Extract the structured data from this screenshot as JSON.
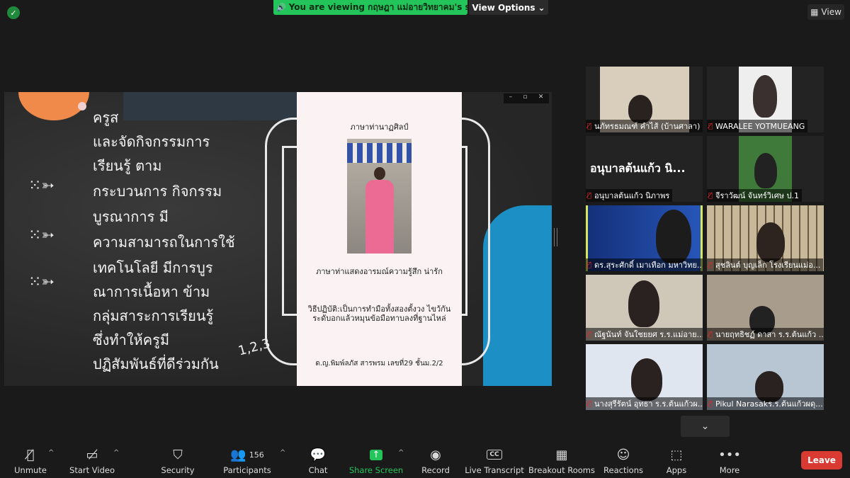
{
  "top": {
    "viewing_text": "You are viewing กฤษฎา แม่อายวิทยาคม's screen",
    "view_options": "View Options",
    "view_button": "View"
  },
  "share": {
    "board_lines": [
      "ครูส",
      "และจัดกิจกรรมการ",
      "เรียนรู้ ตาม",
      "กระบวนการ กิจกรรม",
      "บูรณาการ มี",
      "ความสามารถในการใช้",
      "เทคโนโลยี มีการบูร",
      "ณาการเนื้อหา ข้าม",
      "กลุ่มสาระการเรียนรู้",
      "ซึ่งทำให้ครูมี",
      "ปฏิสัมพันธ์ที่ดีร่วมกัน"
    ],
    "scribble": "1,2,3",
    "card": {
      "title": "ภาษาท่านาฏศิลป์",
      "caption": "ภาษาท่าแสดงอารมณ์ความรู้สึก น่ารัก",
      "method": "วิธีปฏิบัติ:เป็นการทำมือทั้งสองตั้งวง ไขว้กันระดับอกแล้วหมุนข้อมือทาบลงที่ฐานไหล่",
      "student": "ด.ญ.พิมพ์ลภัส สารพรม เลขที่29 ชั้นม.2/2"
    }
  },
  "participants": [
    {
      "name": "นภัทรธมณฑ์ คำไส้ (บ้านศาลา)",
      "bg": "#d9cdbc"
    },
    {
      "name": "WARALEE YOTMUEANG",
      "bg": "#eeeeee"
    },
    {
      "name": "อนุบาลต้นแก้ว นิภาพร",
      "big": "อนุบาลต้นแก้ว นิ...",
      "bg": "#232323"
    },
    {
      "name": "จีราวัฒน์ จันทร์วิเศษ ป.1",
      "bg": "#3f7a3a"
    },
    {
      "name": "ดร.สุระศักดิ์ เมาเทือก มหาวิทย...",
      "bg": "#1e3f8a",
      "active": true
    },
    {
      "name": "สุชลินต์ บุญเล็ก โรงเรียนแม่อ...",
      "bg": "#c8b89a"
    },
    {
      "name": "ณัฐนันท์ จันใชยยศ ร.ร.แม่อาย...",
      "bg": "#cfc8b8"
    },
    {
      "name": "นายฤทธิชฏ์ ดาสา ร.ร.ต้นแก้ว ...",
      "bg": "#a89c8c"
    },
    {
      "name": "นางสุรีรัตน์ อุทธา ร.ร.ต้นแก้วผ...",
      "bg": "#dfe6ef"
    },
    {
      "name": "Pikul Narasakร.ร.ต้นแก้วผดุ...",
      "bg": "#b8c6d4"
    }
  ],
  "toolbar": {
    "unmute": "Unmute",
    "start_video": "Start Video",
    "security": "Security",
    "participants": "Participants",
    "participant_count": "156",
    "chat": "Chat",
    "share_screen": "Share Screen",
    "record": "Record",
    "live_transcript": "Live Transcript",
    "cc": "CC",
    "breakout_rooms": "Breakout Rooms",
    "reactions": "Reactions",
    "apps": "Apps",
    "more": "More",
    "leave": "Leave"
  },
  "colors": {
    "accent_green": "#23c45a",
    "leave_red": "#d93a32",
    "active_speaker": "#d6e85a"
  }
}
